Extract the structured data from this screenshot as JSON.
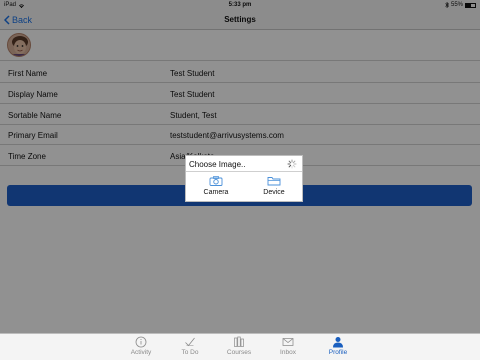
{
  "status_bar": {
    "device": "iPad",
    "time": "5:33 pm",
    "battery": "55%"
  },
  "nav": {
    "back_label": "Back",
    "title": "Settings"
  },
  "profile_fields": [
    {
      "label": "First Name",
      "value": "Test Student"
    },
    {
      "label": "Display Name",
      "value": "Test Student"
    },
    {
      "label": "Sortable Name",
      "value": "Student, Test"
    },
    {
      "label": "Primary Email",
      "value": "teststudent@arrivusystems.com"
    },
    {
      "label": "Time Zone",
      "value": "Asia/Kolkata"
    }
  ],
  "popup": {
    "title": "Choose Image..",
    "options": [
      {
        "label": "Camera",
        "icon": "camera-icon"
      },
      {
        "label": "Device",
        "icon": "folder-icon"
      }
    ]
  },
  "tabs": [
    {
      "label": "Activity",
      "icon": "info-icon",
      "active": false
    },
    {
      "label": "To Do",
      "icon": "checkmark-icon",
      "active": false
    },
    {
      "label": "Courses",
      "icon": "books-icon",
      "active": false
    },
    {
      "label": "Inbox",
      "icon": "envelope-icon",
      "active": false
    },
    {
      "label": "Profile",
      "icon": "person-icon",
      "active": true
    }
  ],
  "colors": {
    "accent": "#1a73e8",
    "button_blue": "#1f5fc8",
    "active_tab": "#1a5fbf",
    "inactive_tab": "#8a8a8a"
  }
}
